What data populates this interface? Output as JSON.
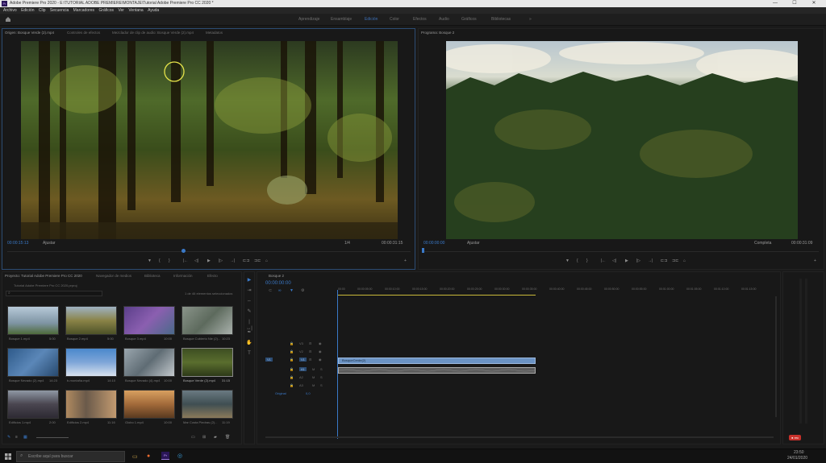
{
  "window": {
    "title": "Adobe Premiere Pro 2020 - E:\\TUTORIAL ADOBE PREMIERE\\MONTAJE\\Tutorial Adobe Premiere Pro CC 2020 *",
    "app_icon": "Pr",
    "minimize": "—",
    "maximize": "☐",
    "close": "✕"
  },
  "menu": [
    "Archivo",
    "Edición",
    "Clip",
    "Secuencia",
    "Marcadores",
    "Gráficos",
    "Ver",
    "Ventana",
    "Ayuda"
  ],
  "workspaces": {
    "home_icon": "home-icon",
    "items": [
      "Aprendizaje",
      "Ensamblaje",
      "Edición",
      "Color",
      "Efectos",
      "Audio",
      "Gráficos",
      "Bibliotecas"
    ],
    "active": "Edición",
    "more": "»"
  },
  "source_monitor": {
    "tabs": [
      "Origen: Bosque Verde (2).mp4",
      "Controles de efectos",
      "Mezclador de clip de audio: Bosque Verde (2).mp4",
      "Metadatos"
    ],
    "timecode_in": "00:00:15:13",
    "fit": "Ajustar",
    "fraction": "1/4",
    "duration": "00:00:31:15"
  },
  "program_monitor": {
    "tabs": [
      "Programa: Bosque 2"
    ],
    "timecode": "00:00:00:00",
    "fit": "Ajustar",
    "quality": "Completa",
    "duration": "00:00:31:09"
  },
  "transport": {
    "buttons": [
      "▼",
      "{",
      "}",
      "|←",
      "◁|",
      "▶",
      "|▷",
      "→|",
      "⊏⊐",
      "⊐⊏",
      "⌂",
      "+"
    ]
  },
  "project_panel": {
    "tabs": [
      "Proyecto: Tutorial Adobe Premiere Pro CC 2020",
      "Navegador de medios",
      "Biblioteca",
      "Información",
      "Efecto"
    ],
    "project_file": "Tutorial Adobe Premiere Pro CC 2020.prproj",
    "selection_info": "1 de 46 elementos seleccionados",
    "clips": [
      {
        "name": "Bosque 1.mp4",
        "duration": "5:00",
        "color": "#7f95a5"
      },
      {
        "name": "Bosque 2.mp4",
        "duration": "5:00",
        "color": "#6a6d3c"
      },
      {
        "name": "Bosque 3.mp4",
        "duration": "10:00",
        "color": "#6a4d8f"
      },
      {
        "name": "Bosque Cubierto Nie (2)...",
        "duration": "10:23",
        "color": "#6f7a6e"
      },
      {
        "name": "Bosque Nevado (2).mp4",
        "duration": "14:23",
        "color": "#3b6a99"
      },
      {
        "name": "b-montaña.mp4",
        "duration": "14:10",
        "color": "#3d77b5"
      },
      {
        "name": "Bosque Nevado (4).mp4",
        "duration": "10:00",
        "color": "#7b8a94"
      },
      {
        "name": "Bosque Verde (2).mp4",
        "duration": "31:15",
        "color": "#4f6331"
      },
      {
        "name": "Edificios 1.mp4",
        "duration": "2:00",
        "color": "#4d4a55"
      },
      {
        "name": "Edificios 2.mp4",
        "duration": "11:16",
        "color": "#8d6a4a"
      },
      {
        "name": "Globo 1.mp4",
        "duration": "10:00",
        "color": "#8a5d3a"
      },
      {
        "name": "Mar Costa Piedras (2)...",
        "duration": "11:19",
        "color": "#4a5c62"
      }
    ]
  },
  "tools": [
    "▶",
    "⇥",
    "⇔",
    "✎",
    "|↔|",
    "✒",
    "✋",
    "T"
  ],
  "timeline": {
    "tab": "Bosque 2",
    "timecode": "00:00:00:00",
    "ruler": [
      "00:00",
      "00:00:05:00",
      "00:00:10:00",
      "00:00:15:00",
      "00:00:20:00",
      "00:00:25:00",
      "00:00:30:00",
      "00:00:35:00",
      "00:00:40:00",
      "00:00:45:00",
      "00:00:50:00",
      "00:00:55:00",
      "00:01:00:00",
      "00:01:05:00",
      "00:01:10:00",
      "00:01:15:00"
    ],
    "video_tracks": [
      "V3",
      "V2",
      "V1"
    ],
    "audio_tracks": [
      "A1",
      "A2",
      "A3"
    ],
    "master": "Original",
    "master_value": "0,0",
    "clip_label": "BosqueCerde(2)",
    "track_buttons": [
      "M",
      "S"
    ]
  },
  "rec_badge": "● rec",
  "taskbar": {
    "start_icon": "windows-icon",
    "search_placeholder": "Escribe aquí para buscar",
    "time": "23:50",
    "date": "24/01/2020"
  }
}
